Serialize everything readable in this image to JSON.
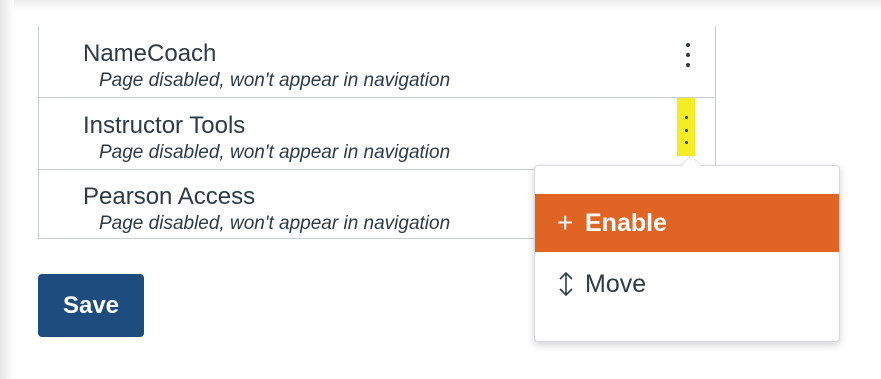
{
  "nav_items": [
    {
      "title": "NameCoach",
      "subtitle": "Page disabled, won't appear in navigation"
    },
    {
      "title": "Instructor Tools",
      "subtitle": "Page disabled, won't appear in navigation"
    },
    {
      "title": "Pearson Access",
      "subtitle": "Page disabled, won't appear in navigation"
    }
  ],
  "save_label": "Save",
  "menu": {
    "enable_label": "Enable",
    "enable_icon": "plus-icon",
    "move_label": "Move",
    "move_icon": "move-arrows-icon"
  },
  "colors": {
    "primary_button": "#1e4c7f",
    "menu_highlight": "#e06525",
    "kebab_highlight": "#f4ec25",
    "text": "#2d3b45"
  }
}
